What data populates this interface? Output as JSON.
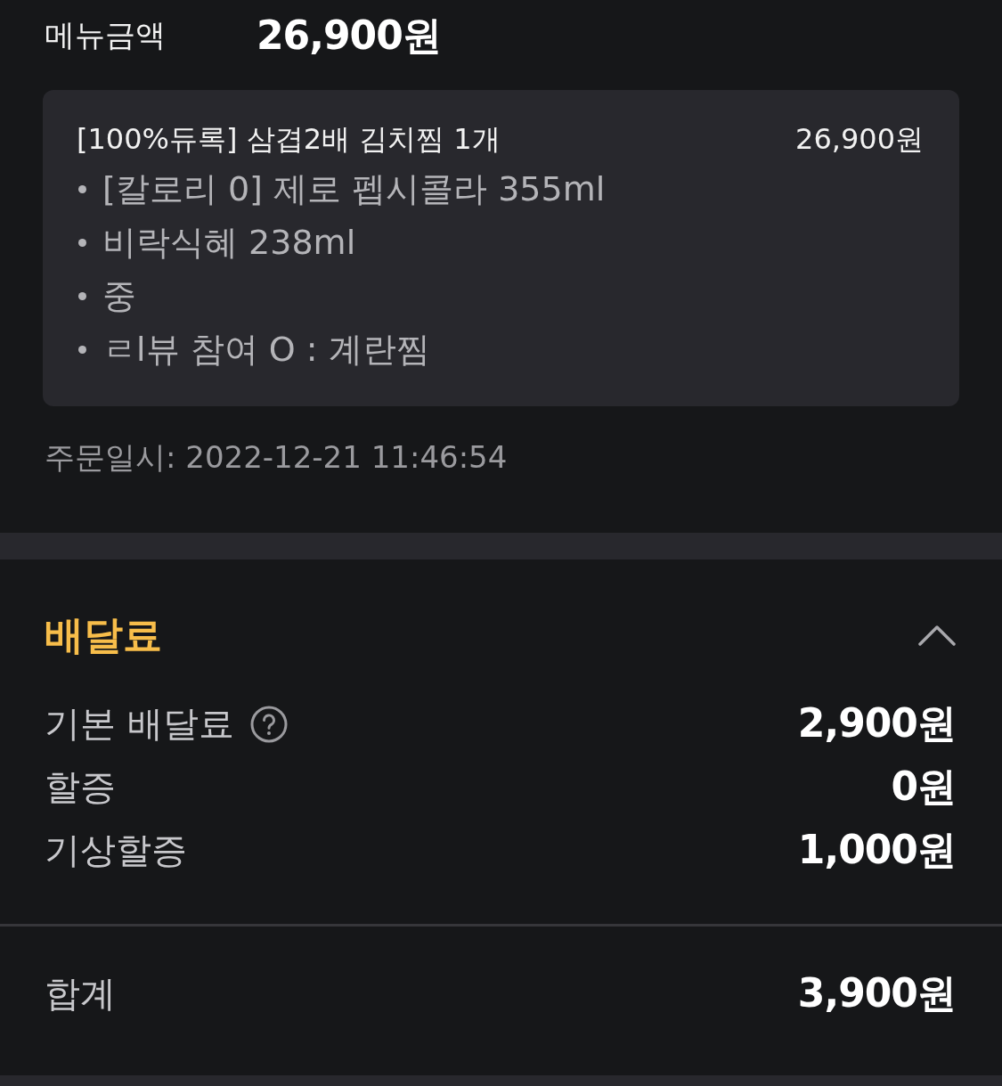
{
  "menu_total": {
    "label": "메뉴금액",
    "amount": "26,900원"
  },
  "order_card": {
    "item": {
      "name": "[100%듀록] 삼겹2배 김치찜 1개",
      "price": "26,900원"
    },
    "options": [
      "[칼로리 0] 제로 펩시콜라 355ml",
      "비락식혜 238ml",
      "중",
      "ㄹl뷰 참여 O : 계란찜"
    ]
  },
  "order_time": "주문일시: 2022-12-21 11:46:54",
  "delivery_fee": {
    "title": "배달료",
    "expanded": true,
    "rows": [
      {
        "label": "기본 배달료",
        "help": true,
        "amount": "2,900원"
      },
      {
        "label": "할증",
        "help": false,
        "amount": "0원"
      },
      {
        "label": "기상할증",
        "help": false,
        "amount": "1,000원"
      }
    ],
    "total": {
      "label": "합계",
      "amount": "3,900원"
    }
  }
}
